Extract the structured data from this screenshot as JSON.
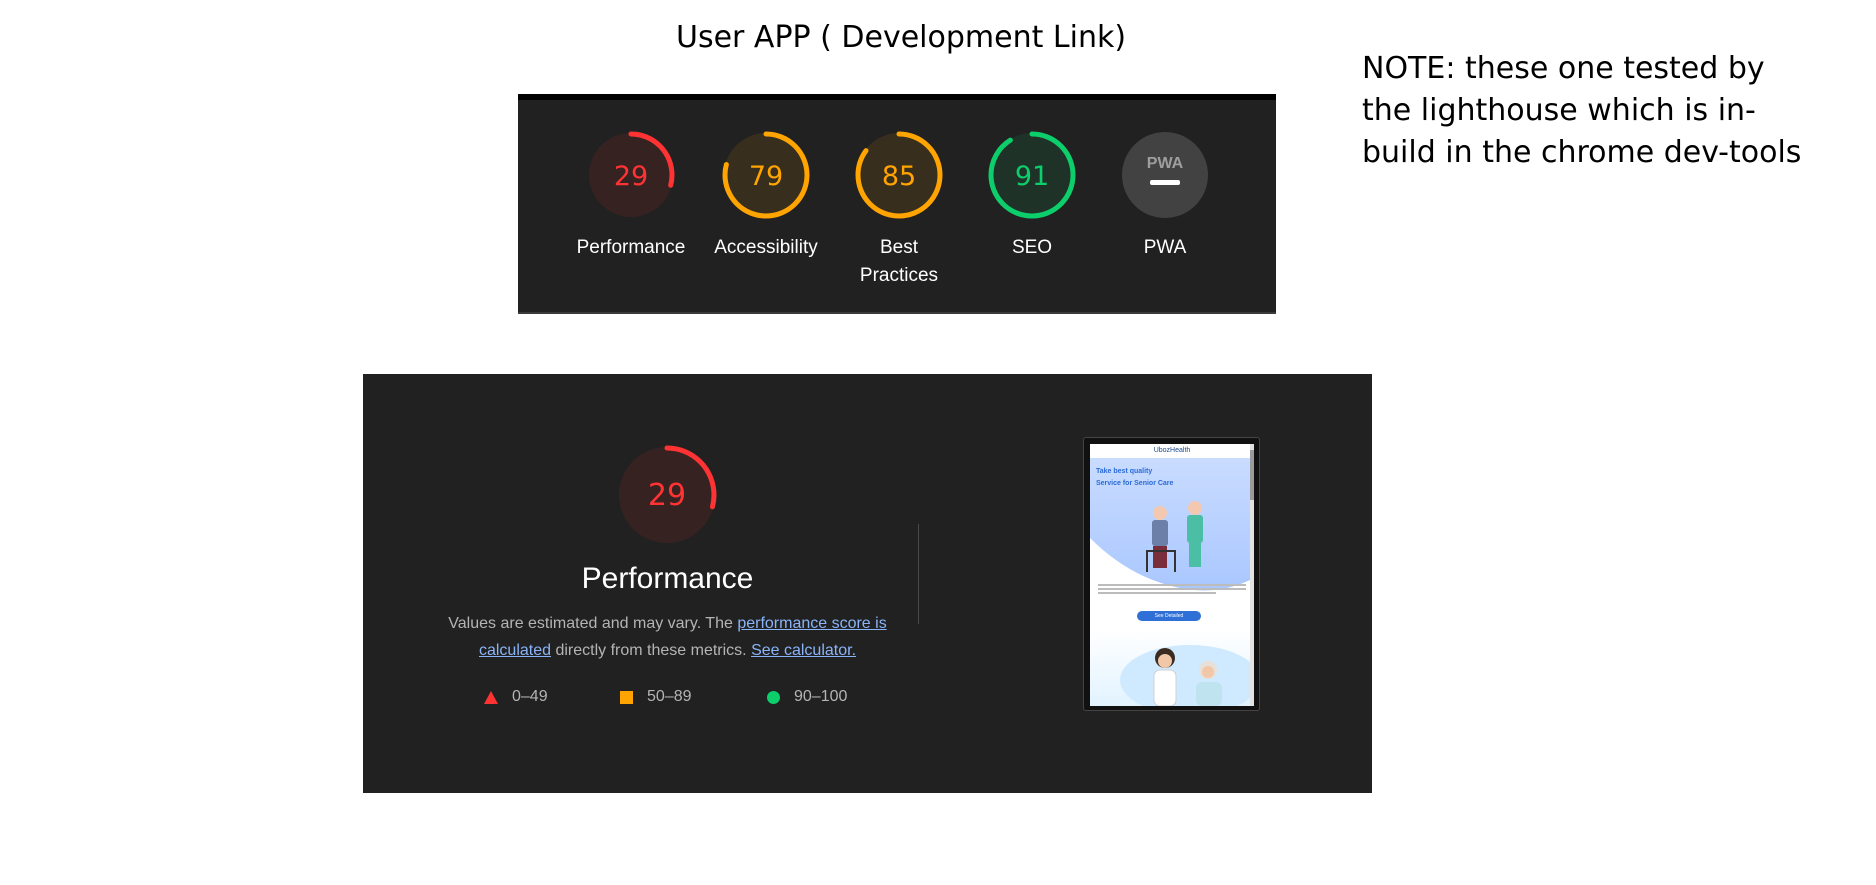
{
  "page": {
    "title": "User APP ( Development Link)",
    "note_lines": [
      "NOTE: these one tested by",
      "the lighthouse which is in-",
      "build in the chrome dev-tools"
    ]
  },
  "colors": {
    "fail": "#ff3333",
    "average": "#ffa400",
    "pass": "#0cce6b",
    "neutral": "#9e9e9e",
    "panel_bg": "#212121"
  },
  "scores": [
    {
      "label_lines": [
        "Performance"
      ],
      "value": "29",
      "fraction": 0.29,
      "rating": "fail"
    },
    {
      "label_lines": [
        "Accessibility"
      ],
      "value": "79",
      "fraction": 0.79,
      "rating": "average"
    },
    {
      "label_lines": [
        "Best",
        "Practices"
      ],
      "value": "85",
      "fraction": 0.85,
      "rating": "average"
    },
    {
      "label_lines": [
        "SEO"
      ],
      "value": "91",
      "fraction": 0.91,
      "rating": "pass"
    },
    {
      "label_lines": [
        "PWA"
      ],
      "value": "",
      "badge": "PWA",
      "rating": "neutral"
    }
  ],
  "performance": {
    "score": "29",
    "fraction": 0.29,
    "title": "Performance",
    "desc_before": "Values are estimated and may vary. The ",
    "desc_link1": "performance score is calculated",
    "desc_middle": " directly from these metrics. ",
    "desc_link2": "See calculator.",
    "legend": [
      {
        "shape": "triangle",
        "range": "0–49"
      },
      {
        "shape": "square",
        "range": "50–89"
      },
      {
        "shape": "circle",
        "range": "90–100"
      }
    ]
  },
  "thumbnail": {
    "brand": "UbozHealth",
    "hero_lines": [
      "Take best quality",
      "Service for Senior Care"
    ],
    "button_label": "See Detailed"
  }
}
